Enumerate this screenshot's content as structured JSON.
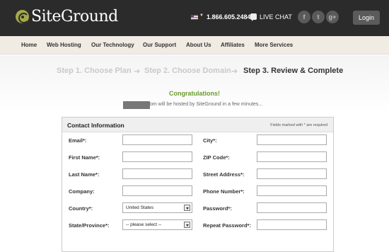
{
  "header": {
    "logo_text": "SiteGround",
    "phone": "1.866.605.2484",
    "chat_label": "LIVE CHAT",
    "social": [
      "f",
      "t",
      "g+"
    ],
    "login_label": "Login"
  },
  "nav": [
    "Home",
    "Web Hosting",
    "Our Technology",
    "Our Support",
    "About Us",
    "Affiliates",
    "More Services"
  ],
  "steps": {
    "step1": "Step 1. Choose Plan",
    "step2": "Step 2. Choose Domain",
    "step3": "Step 3. Review & Complete",
    "arrow": "➔"
  },
  "congrats": {
    "title": "Congratulations!",
    "message": "om will be hosted by SiteGround in a few minutes..."
  },
  "form": {
    "title": "Contact Information",
    "note": "Fields marked with * are required",
    "left": [
      {
        "label": "Email*:",
        "type": "text",
        "value": ""
      },
      {
        "label": "First Name*:",
        "type": "text",
        "value": ""
      },
      {
        "label": "Last Name*:",
        "type": "text",
        "value": ""
      },
      {
        "label": "Company:",
        "type": "text",
        "value": ""
      },
      {
        "label": "Country*:",
        "type": "select",
        "value": "United States"
      },
      {
        "label": "State/Province*:",
        "type": "select",
        "value": "-- please select --"
      }
    ],
    "right": [
      {
        "label": "City*:",
        "type": "text",
        "value": ""
      },
      {
        "label": "ZIP Code*:",
        "type": "text",
        "value": ""
      },
      {
        "label": "Street Address*:",
        "type": "text",
        "value": ""
      },
      {
        "label": "Phone Number*:",
        "type": "text",
        "value": ""
      },
      {
        "label": "Password*:",
        "type": "text",
        "value": ""
      },
      {
        "label": "Repeat Password*:",
        "type": "text",
        "value": ""
      }
    ]
  },
  "colors": {
    "header_bg": "#2b2b2b",
    "nav_bg": "#f0ebe3",
    "congrats_green": "#6a9a2e",
    "logo_mark": "#a5a94a"
  }
}
